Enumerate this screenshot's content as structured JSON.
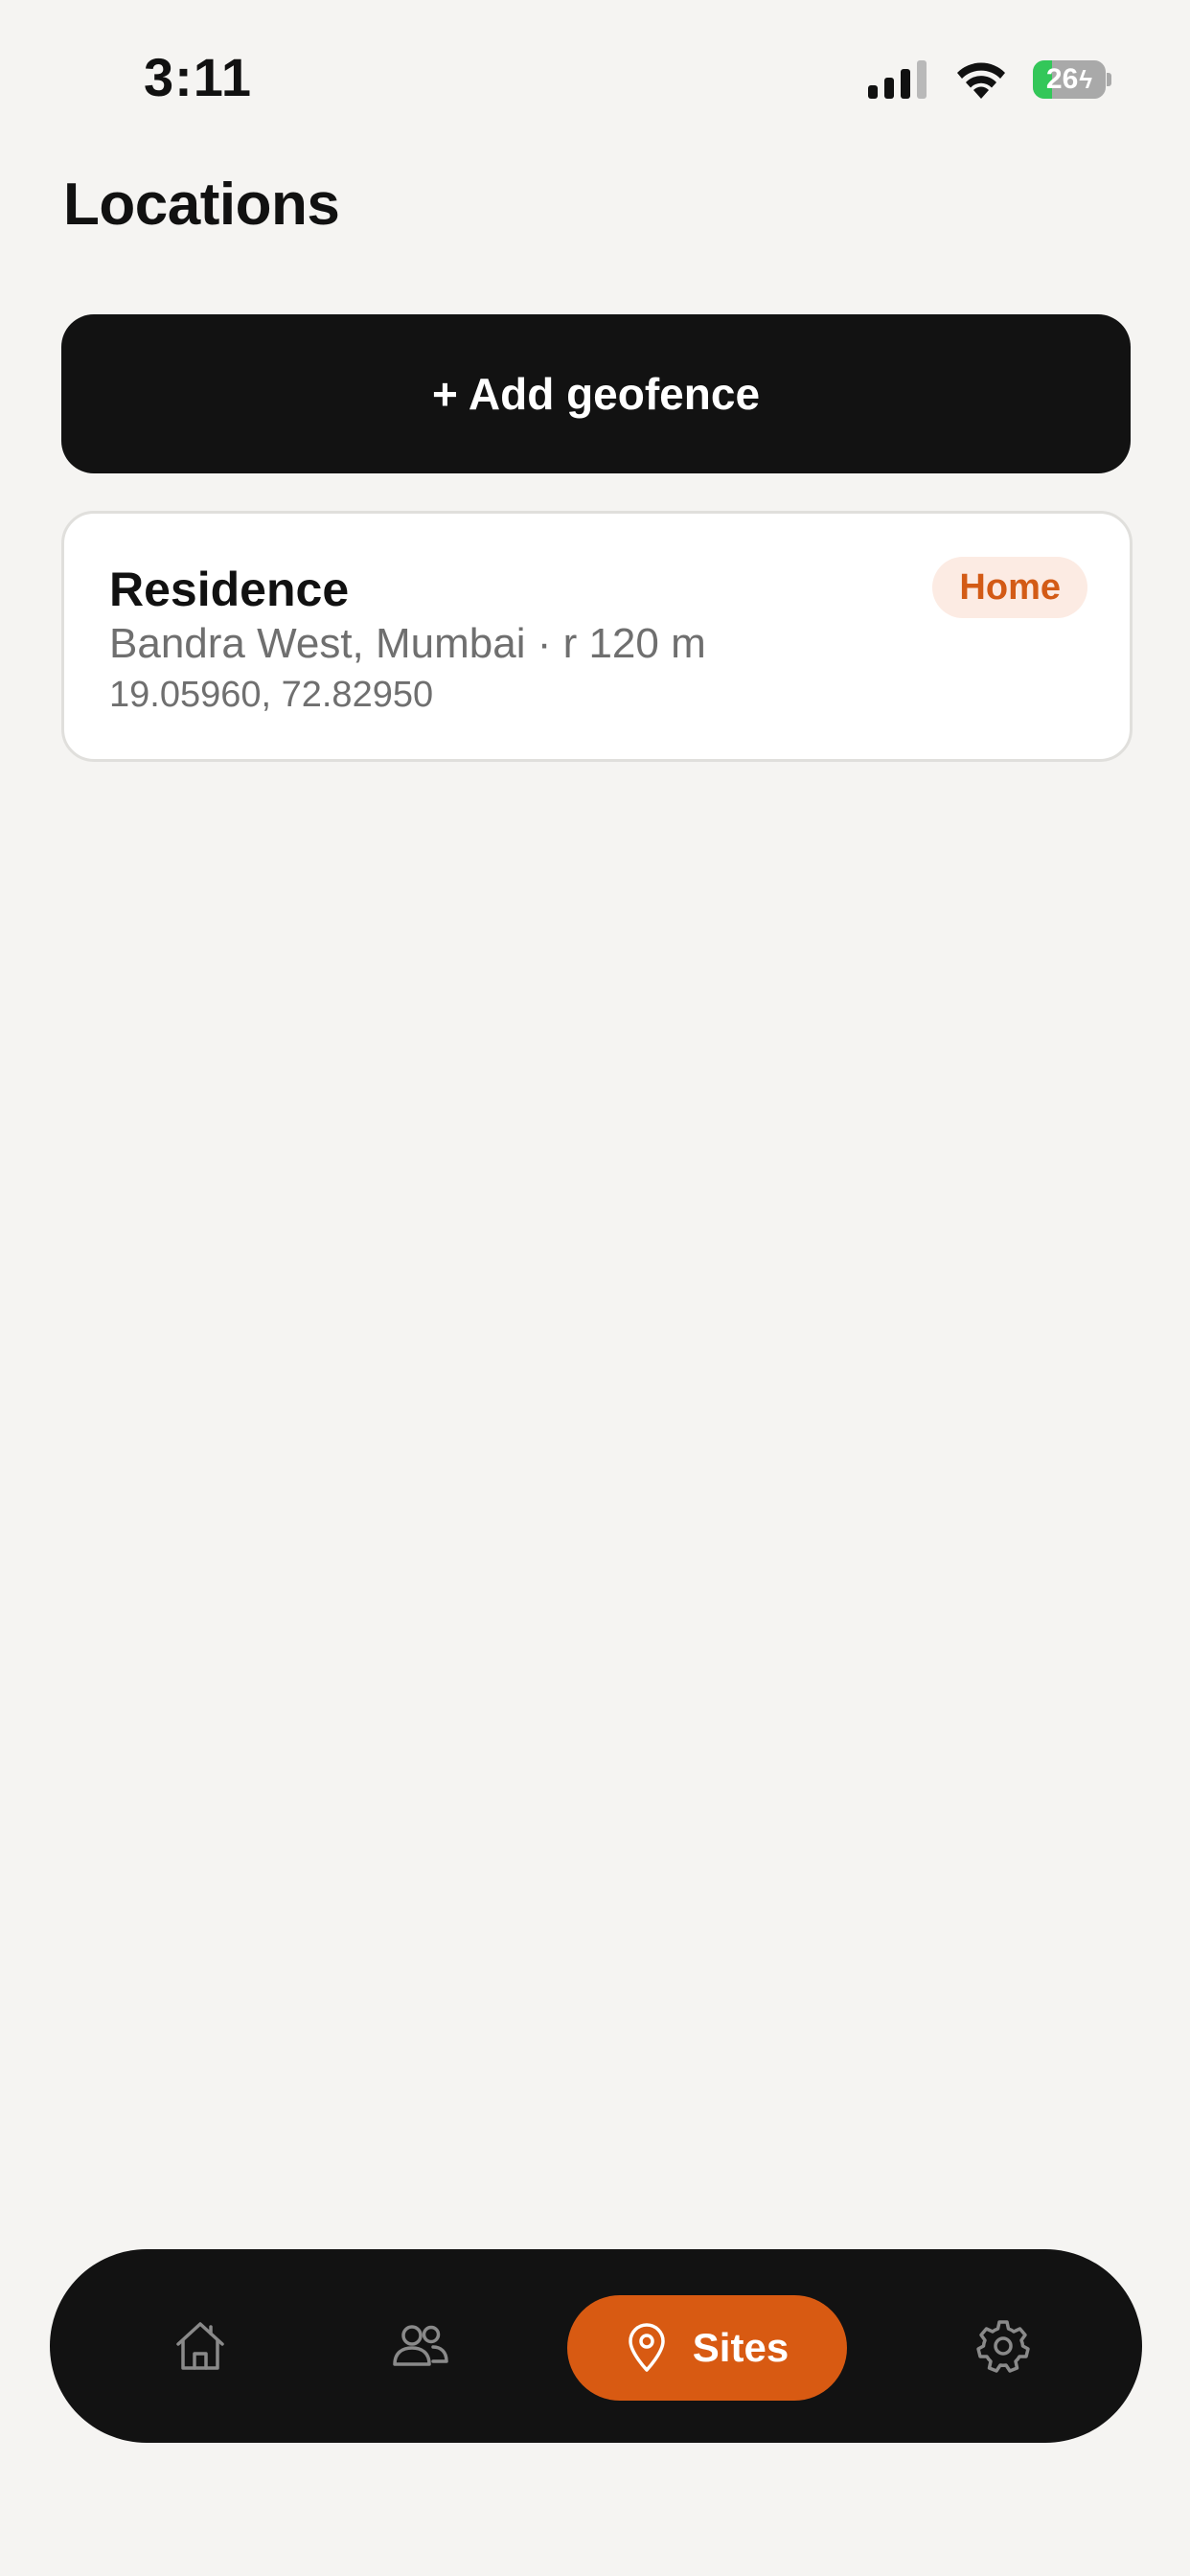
{
  "status_bar": {
    "time": "3:11",
    "battery_level": 26,
    "battery_text": "26",
    "signal_icon": "cellular-signal-icon",
    "wifi_icon": "wifi-icon",
    "battery_icon": "battery-charging-icon"
  },
  "header": {
    "title": "Locations"
  },
  "actions": {
    "add_geofence_label": "+ Add geofence"
  },
  "locations": [
    {
      "name": "Residence",
      "subtitle": "Bandra West, Mumbai · r 120 m",
      "coordinates": "19.05960, 72.82950",
      "badge": "Home"
    }
  ],
  "tab_bar": {
    "items": [
      {
        "icon": "home-icon",
        "label": "",
        "active": false
      },
      {
        "icon": "people-icon",
        "label": "",
        "active": false
      },
      {
        "icon": "location-pin-icon",
        "label": "Sites",
        "active": true
      },
      {
        "icon": "gear-icon",
        "label": "",
        "active": false
      }
    ]
  },
  "colors": {
    "background": "#f5f4f2",
    "primary_dark": "#121212",
    "accent": "#d85a12",
    "badge_bg": "#fcebe3",
    "badge_text": "#d35b16",
    "battery_green": "#33c759"
  }
}
